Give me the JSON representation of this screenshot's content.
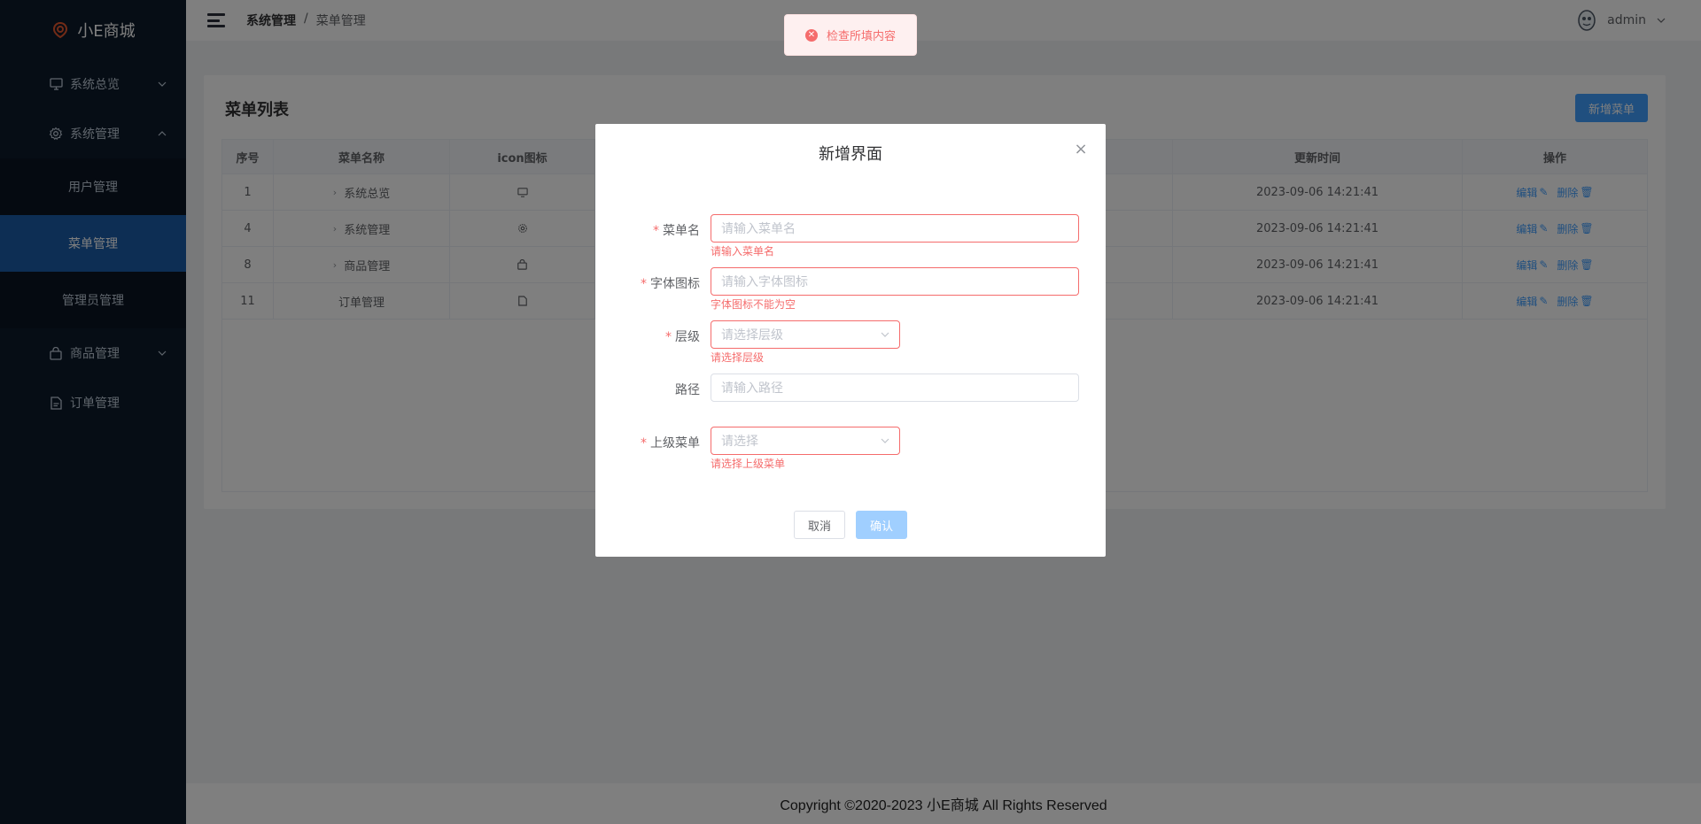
{
  "app": {
    "logo_text": "小E商城"
  },
  "sidebar": {
    "items": [
      {
        "label": "系统总览",
        "icon": "monitor-icon"
      },
      {
        "label": "系统管理",
        "icon": "gear-icon"
      },
      {
        "label": "商品管理",
        "icon": "bag-icon"
      },
      {
        "label": "订单管理",
        "icon": "document-icon"
      }
    ],
    "sub_items": [
      {
        "label": "用户管理"
      },
      {
        "label": "菜单管理"
      },
      {
        "label": "管理员管理"
      }
    ]
  },
  "header": {
    "breadcrumb": [
      "系统管理",
      "/",
      "菜单管理"
    ],
    "username": "admin"
  },
  "card": {
    "title": "菜单列表",
    "add_button": "新增菜单",
    "columns": [
      "序号",
      "菜单名称",
      "icon图标",
      "更新时间",
      "操作"
    ],
    "rows": [
      {
        "no": "1",
        "name": "系统总览",
        "icon": "monitor-icon",
        "time": "2023-09-06 14:21:41"
      },
      {
        "no": "4",
        "name": "系统管理",
        "icon": "gear-icon",
        "time": "2023-09-06 14:21:41"
      },
      {
        "no": "8",
        "name": "商品管理",
        "icon": "bag-icon",
        "time": "2023-09-06 14:21:41"
      },
      {
        "no": "11",
        "name": "订单管理",
        "icon": "document-icon",
        "time": "2023-09-06 14:21:41"
      }
    ],
    "edit_label": "编辑",
    "delete_label": "删除"
  },
  "footer": {
    "text": "Copyright ©2020-2023 小E商城 All Rights Reserved"
  },
  "message": {
    "text": "检查所填内容",
    "type": "error"
  },
  "dialog": {
    "title": "新增界面",
    "fields": {
      "menu_name": {
        "label": "菜单名",
        "placeholder": "请输入菜单名",
        "error": "请输入菜单名"
      },
      "icon": {
        "label": "字体图标",
        "placeholder": "请输入字体图标",
        "error": "字体图标不能为空"
      },
      "level": {
        "label": "层级",
        "placeholder": "请选择层级",
        "error": "请选择层级"
      },
      "path": {
        "label": "路径",
        "placeholder": "请输入路径"
      },
      "parent": {
        "label": "上级菜单",
        "placeholder": "请选择",
        "error": "请选择上级菜单"
      }
    },
    "cancel": "取消",
    "confirm": "确认"
  },
  "colors": {
    "sidebar_bg": "#0d1b2a",
    "active": "#1b5da8",
    "primary": "#409eff",
    "danger": "#f56c6c"
  }
}
